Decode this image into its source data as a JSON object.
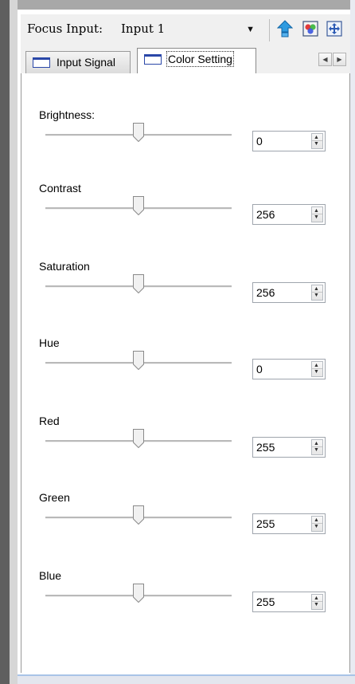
{
  "header": {
    "focus_label": "Focus Input:",
    "focus_value": "Input 1",
    "icons": [
      "up-arrow-icon",
      "color-palette-icon",
      "move-arrows-icon"
    ]
  },
  "tabs": [
    {
      "label": "Input Signal",
      "active": false
    },
    {
      "label": "Color Setting",
      "active": true
    }
  ],
  "settings": [
    {
      "label": "Brightness:",
      "value": "0",
      "slider_fraction": 0.5
    },
    {
      "label": "Contrast",
      "value": "256",
      "slider_fraction": 0.5
    },
    {
      "label": "Saturation",
      "value": "256",
      "slider_fraction": 0.5
    },
    {
      "label": "Hue",
      "value": "0",
      "slider_fraction": 0.5
    },
    {
      "label": "Red",
      "value": "255",
      "slider_fraction": 0.5
    },
    {
      "label": "Green",
      "value": "255",
      "slider_fraction": 0.5
    },
    {
      "label": "Blue",
      "value": "255",
      "slider_fraction": 0.5
    }
  ],
  "colors": {
    "tab_icon": "#2a47a8",
    "up_icon": "#1a8fd6"
  }
}
